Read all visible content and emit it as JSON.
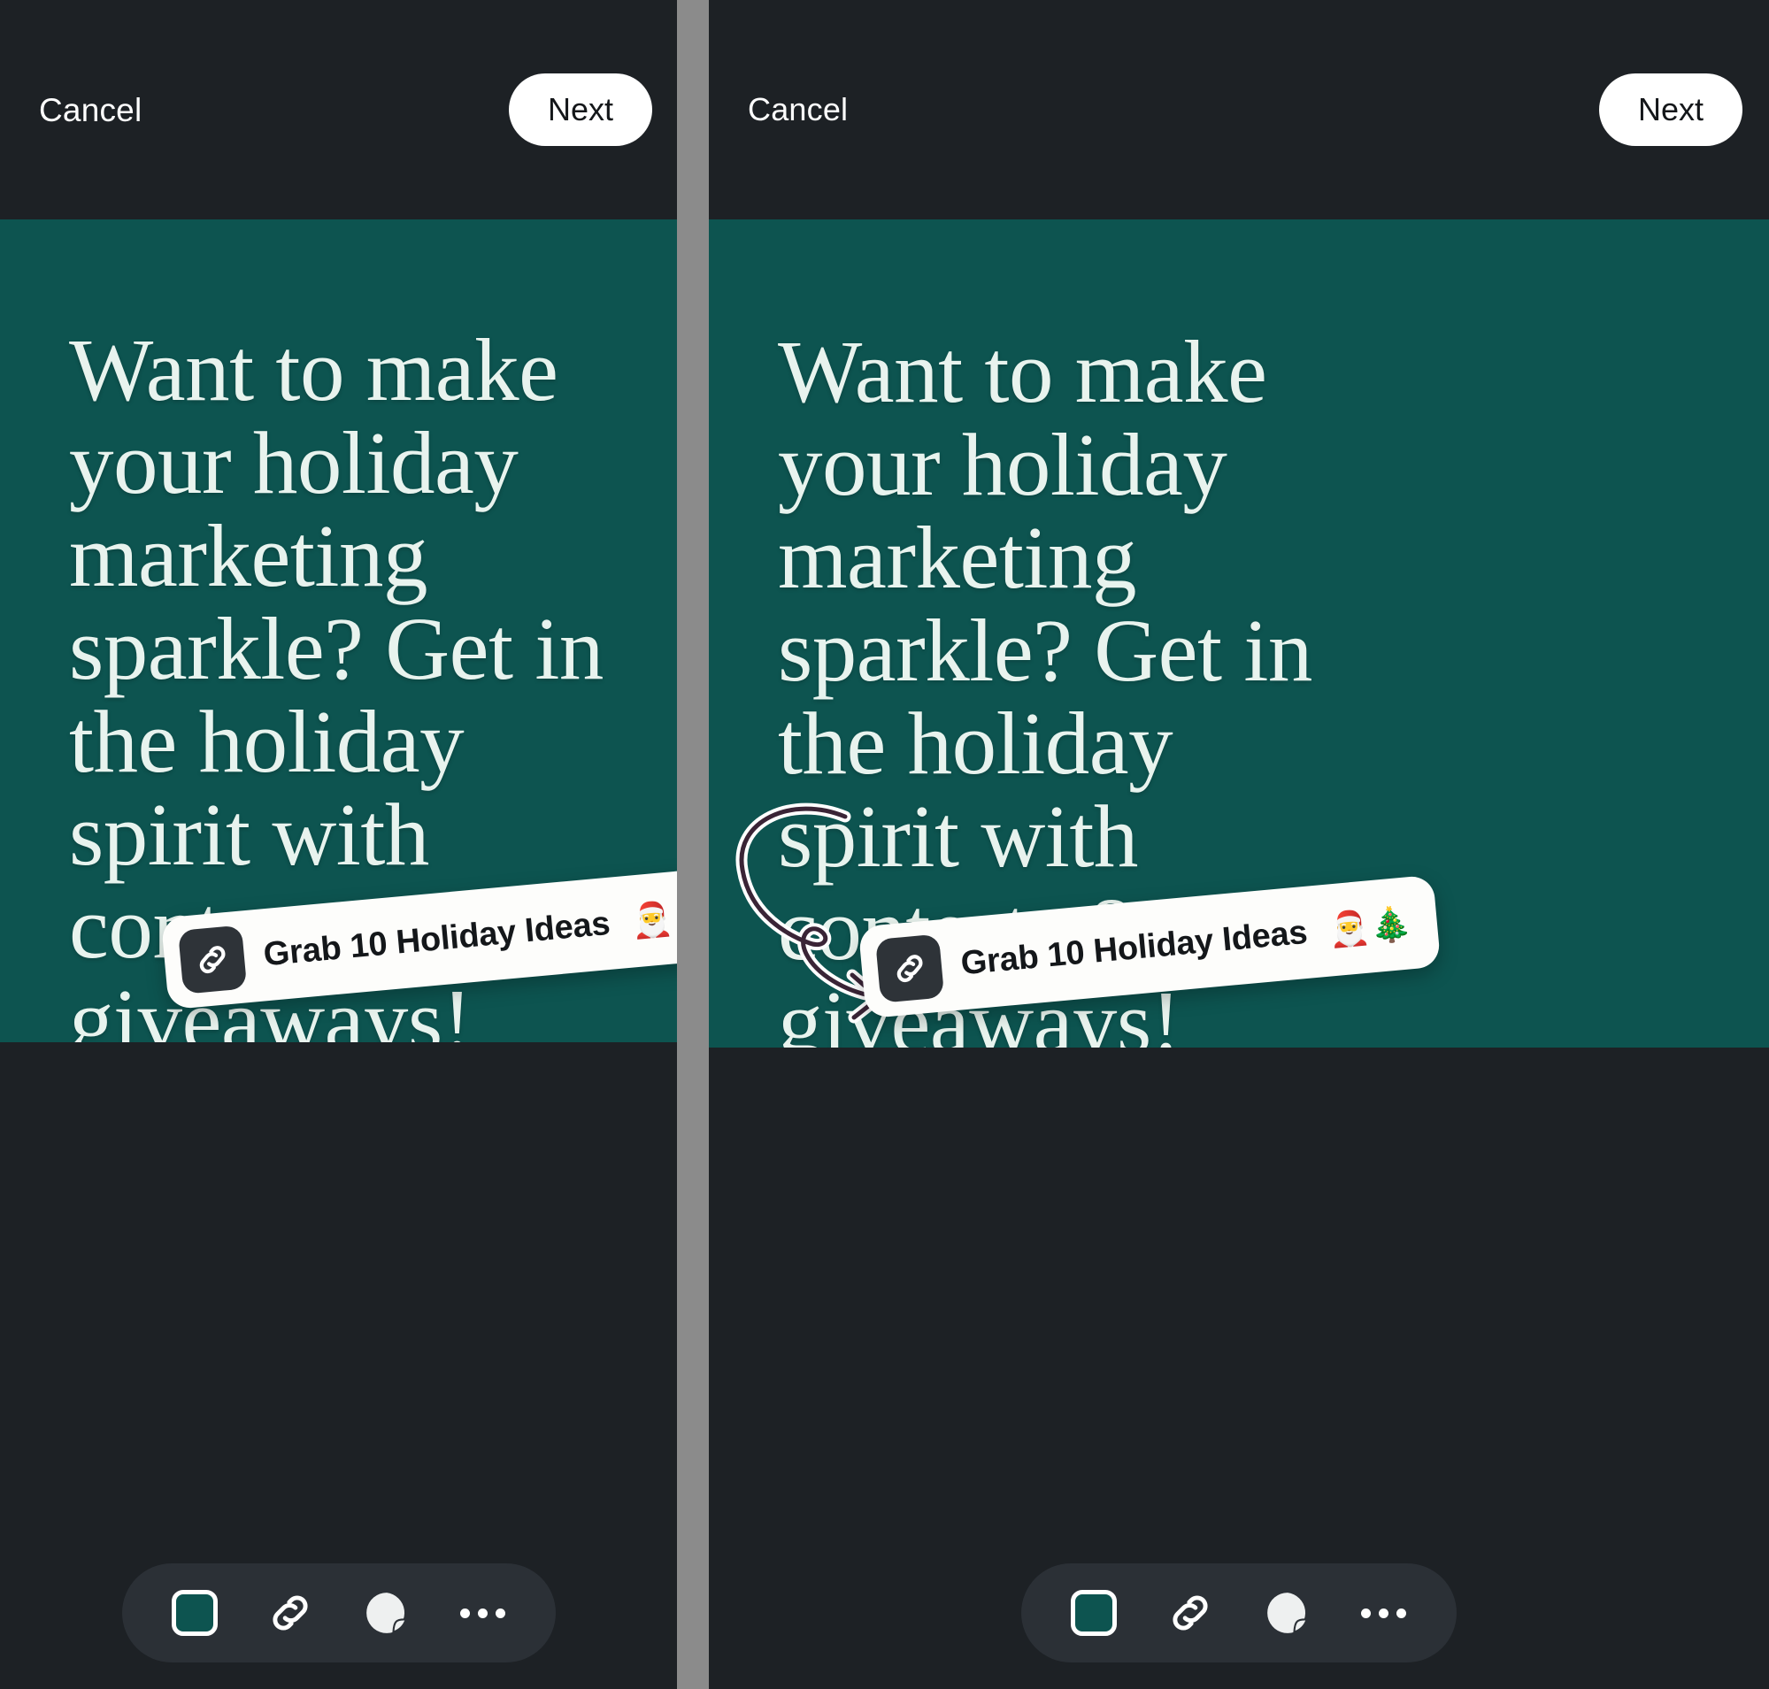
{
  "panels": [
    {
      "id": "left",
      "topbar": {
        "cancel_label": "Cancel",
        "next_label": "Next"
      },
      "canvas": {
        "background_color": "#0d5450",
        "headline": "Want to make your holiday marketing sparkle? Get in the holiday spirit with contests & giveaways!",
        "headline_color": "#e8f3ee",
        "link_sticker": {
          "icon": "link-icon",
          "label": "Grab 10 Holiday Ideas",
          "emojis": "🎅🎄",
          "background_color": "#fdfdfb",
          "text_color": "#14171a",
          "chip_color": "#2e3338"
        },
        "annotation": null
      },
      "toolbar": {
        "items": [
          {
            "icon": "background-color-swatch-icon",
            "label": "Background color",
            "color": "#0d5450"
          },
          {
            "icon": "link-icon",
            "label": "Link"
          },
          {
            "icon": "sticker-icon",
            "label": "Sticker"
          },
          {
            "icon": "more-options-icon",
            "label": "More"
          }
        ]
      }
    },
    {
      "id": "right",
      "topbar": {
        "cancel_label": "Cancel",
        "next_label": "Next"
      },
      "canvas": {
        "background_color": "#0d5450",
        "headline": "Want to make your holiday marketing sparkle? Get in the holiday spirit with contests & giveaways!",
        "headline_color": "#e8f3ee",
        "link_sticker": {
          "icon": "link-icon",
          "label": "Grab 10 Holiday Ideas",
          "emojis": "🎅🎄",
          "background_color": "#fdfdfb",
          "text_color": "#14171a",
          "chip_color": "#2e3338"
        },
        "annotation": {
          "type": "curved-arrow",
          "points_to": "link-sticker",
          "color": "#3a2436",
          "outline_color": "#ffffff"
        }
      },
      "toolbar": {
        "items": [
          {
            "icon": "background-color-swatch-icon",
            "label": "Background color",
            "color": "#0d5450"
          },
          {
            "icon": "link-icon",
            "label": "Link"
          },
          {
            "icon": "sticker-icon",
            "label": "Sticker"
          },
          {
            "icon": "more-options-icon",
            "label": "More"
          }
        ]
      }
    }
  ],
  "divider": {
    "color": "#8b8b8b"
  },
  "theme": {
    "chrome_background": "#1d2125",
    "toolbar_background": "#2b3036",
    "accent_green": "#0d5450",
    "button_white": "#ffffff"
  }
}
